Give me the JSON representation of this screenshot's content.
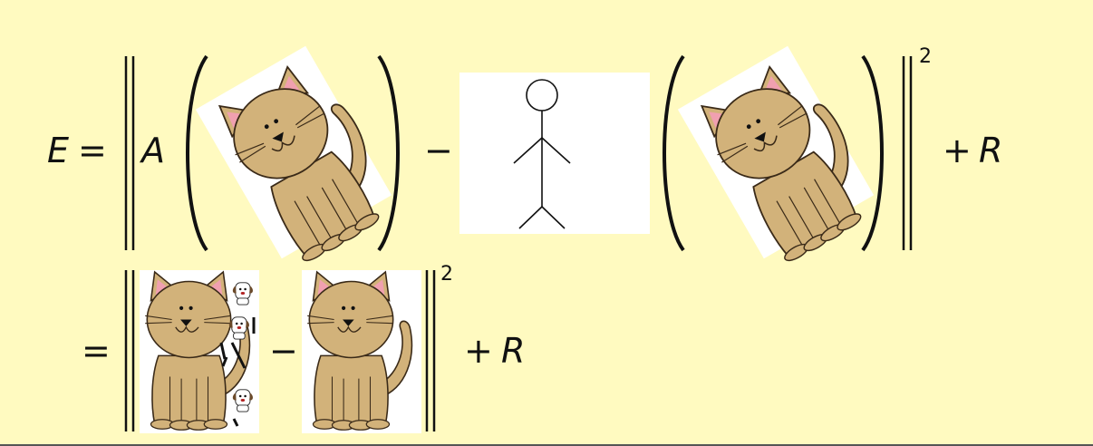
{
  "row1": {
    "lhs_symbol": "E",
    "equals": "=",
    "operator_A": "A",
    "minus": "−",
    "exponent": "2",
    "plus": "+",
    "regularizer": "R"
  },
  "row2": {
    "equals": "=",
    "minus": "−",
    "exponent": "2",
    "plus": "+",
    "regularizer": "R"
  },
  "colors": {
    "background": "#fffac0",
    "cat_fur": "#d2b27a",
    "cat_outline": "#3a2a18",
    "ear_inner": "#f0a0b0",
    "ink": "#111111"
  }
}
